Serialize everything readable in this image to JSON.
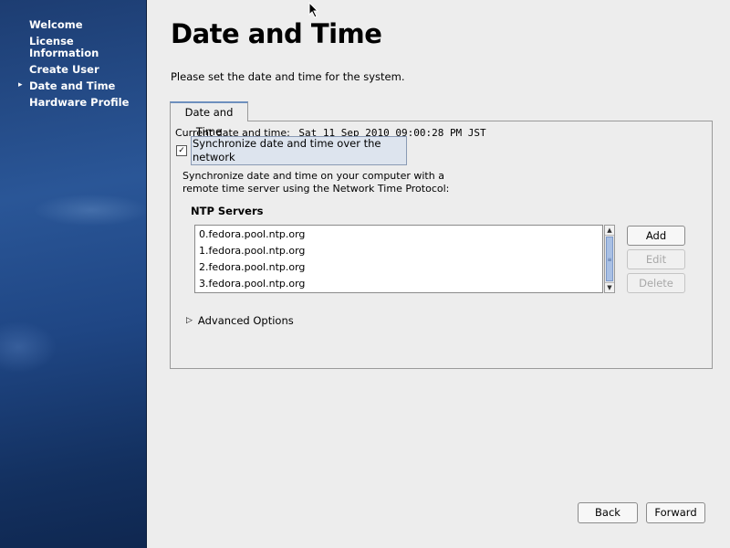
{
  "sidebar": {
    "items": [
      {
        "label": "Welcome",
        "current": false
      },
      {
        "label": "License Information",
        "current": false
      },
      {
        "label": "Create User",
        "current": false
      },
      {
        "label": "Date and Time",
        "current": true
      },
      {
        "label": "Hardware Profile",
        "current": false
      }
    ]
  },
  "page": {
    "title": "Date and Time",
    "intro": "Please set the date and time for the system."
  },
  "tabs": [
    {
      "label": "Date and Time",
      "active": true
    }
  ],
  "datetime": {
    "current_label": "Current date and time:",
    "current_value": "Sat 11 Sep 2010 09:00:28 PM JST",
    "sync_checked": true,
    "sync_label": "Synchronize date and time over the network",
    "description": "Synchronize date and time on your computer with a remote time server using the Network Time Protocol:"
  },
  "ntp": {
    "heading": "NTP Servers",
    "servers": [
      "0.fedora.pool.ntp.org",
      "1.fedora.pool.ntp.org",
      "2.fedora.pool.ntp.org",
      "3.fedora.pool.ntp.org"
    ],
    "buttons": {
      "add": "Add",
      "edit": "Edit",
      "delete": "Delete"
    }
  },
  "advanced": {
    "label": "Advanced Options",
    "expanded": false
  },
  "nav": {
    "back": "Back",
    "forward": "Forward"
  },
  "colors": {
    "sidebar": "#1f4684",
    "tab_accent": "#6e8fbe",
    "scroll_thumb": "#a9c0e4"
  }
}
